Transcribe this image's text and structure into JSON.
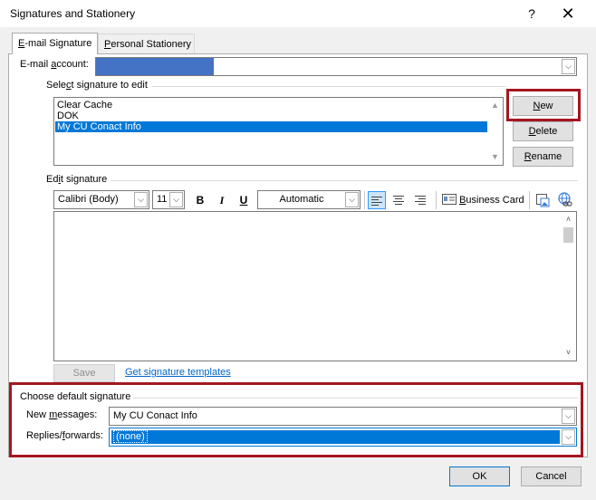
{
  "window": {
    "title": "Signatures and Stationery",
    "help_glyph": "?",
    "close_glyph": "✕"
  },
  "tabs": {
    "email_signature": {
      "key": "E",
      "rest": "-mail Signature"
    },
    "personal_stationery": {
      "key": "P",
      "rest": "ersonal Stationery"
    }
  },
  "email_account": {
    "pre": "E-mail ",
    "key": "a",
    "post": "ccount:"
  },
  "select_signature": {
    "pre": "Sele",
    "key": "c",
    "post": "t signature to edit"
  },
  "signatures": [
    "Clear Cache",
    "DOK",
    "My CU Conact Info"
  ],
  "selected_signature_index": 2,
  "buttons": {
    "new": {
      "key": "N",
      "rest": "ew"
    },
    "delete": {
      "key": "D",
      "rest": "elete"
    },
    "rename": {
      "key": "R",
      "rest": "ename"
    },
    "save": "Save",
    "ok": "OK",
    "cancel": "Cancel"
  },
  "edit_signature": {
    "pre": "Ed",
    "key": "i",
    "post": "t signature"
  },
  "toolbar": {
    "font": "Calibri (Body)",
    "size": "11",
    "bold": "B",
    "italic": "I",
    "underline": "U",
    "color": "Automatic",
    "business_card": {
      "key": "B",
      "rest": "usiness Card"
    }
  },
  "templates_link": "Get signature templates",
  "default_signature": {
    "heading": "Choose default signature",
    "new_messages": {
      "pre": "New ",
      "key": "m",
      "post": "essages:"
    },
    "new_messages_value": "My CU Conact Info",
    "replies": {
      "pre": "Replies/",
      "key": "f",
      "post": "orwards:"
    },
    "replies_value": "(none)"
  },
  "colors": {
    "accent": "#0078d7",
    "highlight": "#a4161f",
    "redacted": "#4472c4",
    "link": "#0066cc"
  },
  "icons": {
    "dropdown": "chevron-down-icon",
    "scroll_up": "chevron-up-icon",
    "scroll_down": "chevron-down-icon",
    "picture": "insert-picture-icon",
    "hyperlink": "hyperlink-icon",
    "business_card": "business-card-icon"
  }
}
